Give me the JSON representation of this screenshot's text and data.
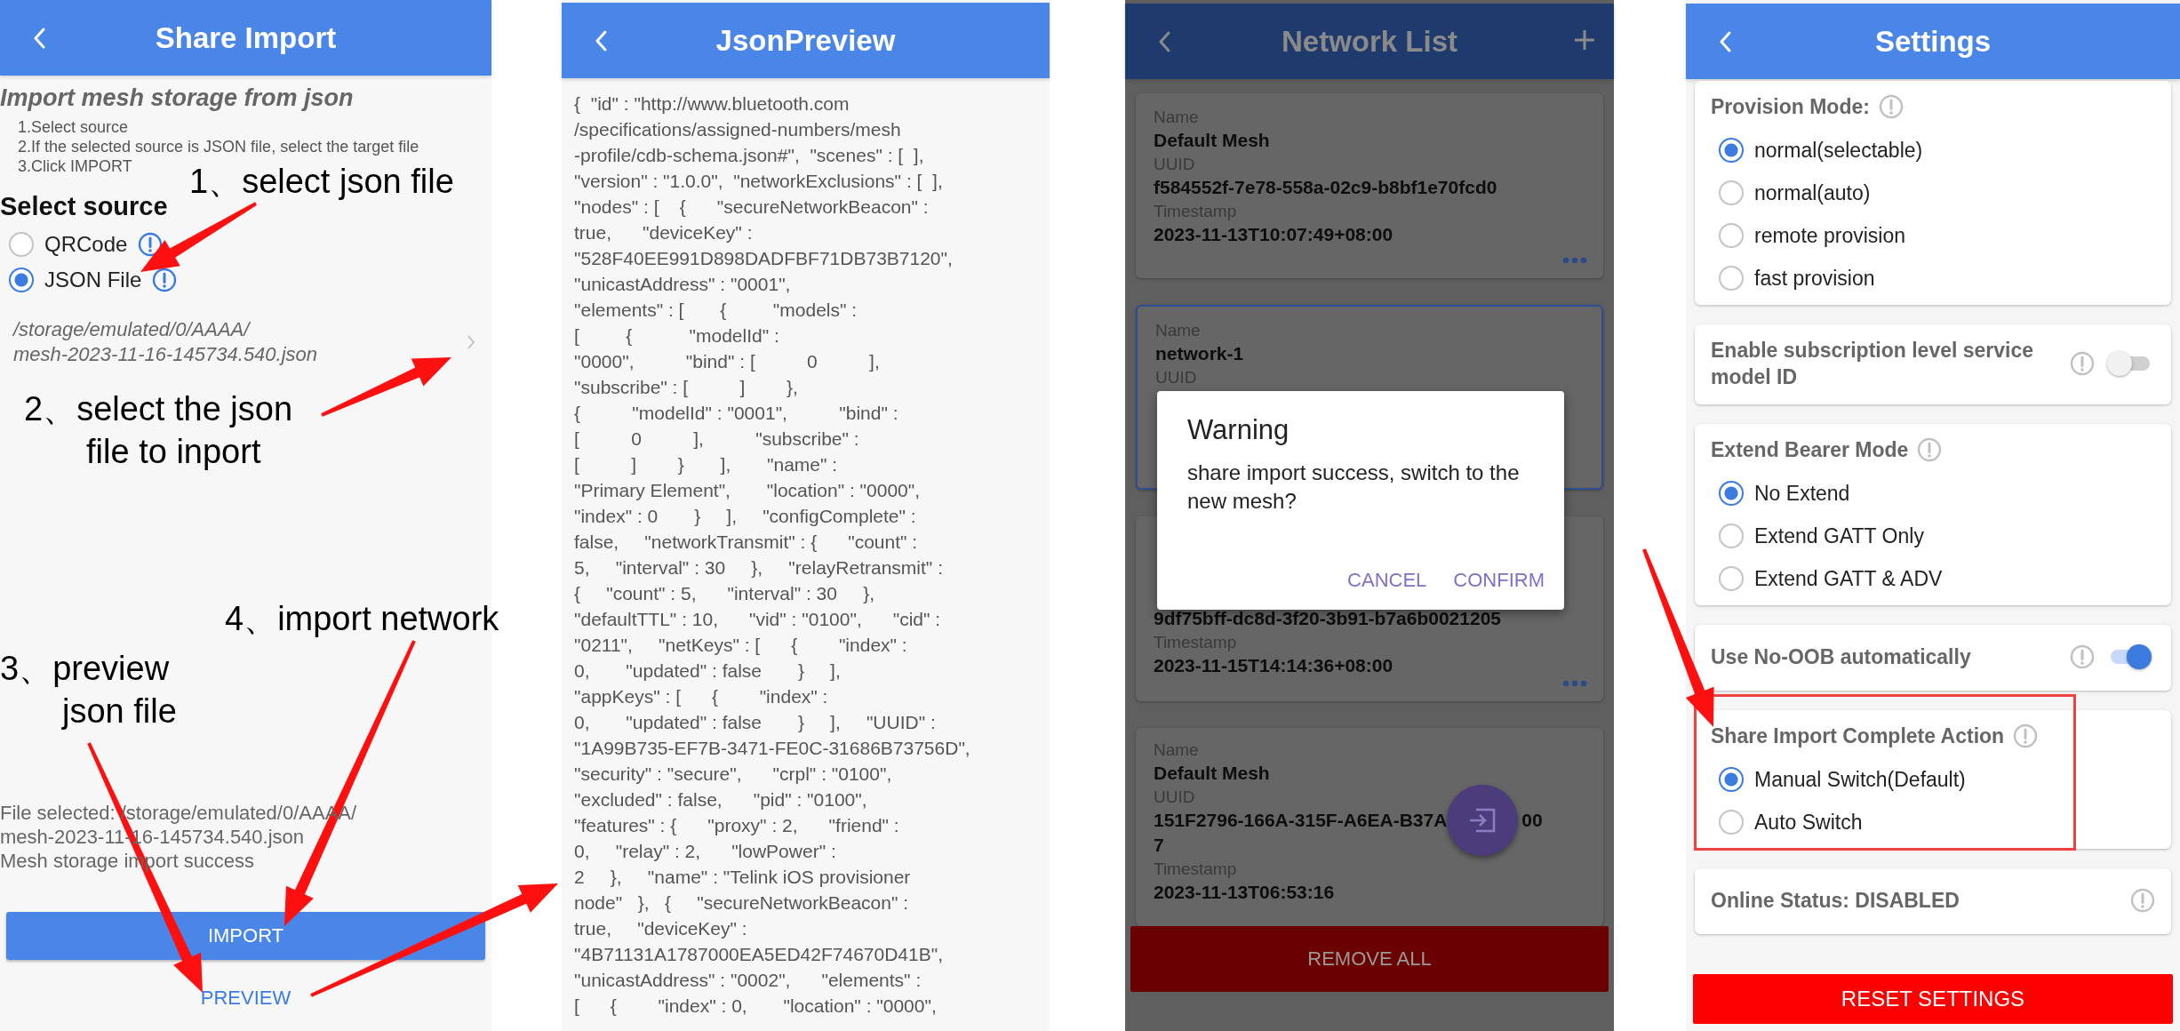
{
  "share_import": {
    "header": {
      "title": "Share Import"
    },
    "heading": "Import mesh storage from json",
    "steps": [
      "1.Select source",
      "2.If the selected source is JSON file, select the target file",
      "3.Click IMPORT"
    ],
    "source_title": "Select source",
    "sources": [
      {
        "label": "QRCode",
        "selected": false
      },
      {
        "label": "JSON File",
        "selected": true
      }
    ],
    "file_path": "/storage/emulated/0/AAAA/\nmesh-2023-11-16-145734.540.json",
    "status_lines": [
      "File selected: /storage/emulated/0/AAAA/\nmesh-2023-11-16-145734.540.json",
      "Mesh storage import success"
    ],
    "import_button": "IMPORT",
    "preview_link": "PREVIEW"
  },
  "json_preview": {
    "header": {
      "title": "JsonPreview"
    },
    "content": "{  \"id\" : \"http://www.bluetooth.com\n/specifications/assigned-numbers/mesh\n-profile/cdb-schema.json#\",  \"scenes\" : [  ],\n\"version\" : \"1.0.0\",  \"networkExclusions\" : [  ],\n\"nodes\" : [    {      \"secureNetworkBeacon\" :\ntrue,      \"deviceKey\" :\n\"528F40EE991D898DADFBF71DB73B7120\",\n\"unicastAddress\" : \"0001\",\n\"elements\" : [       {         \"models\" :\n[         {           \"modelId\" :\n\"0000\",          \"bind\" : [          0          ],\n\"subscribe\" : [          ]        },\n{          \"modelId\" : \"0001\",          \"bind\" :\n[          0          ],          \"subscribe\" :\n[          ]        }       ],       \"name\" :\n\"Primary Element\",       \"location\" : \"0000\",\n\"index\" : 0       }     ],     \"configComplete\" :\nfalse,     \"networkTransmit\" : {      \"count\" :\n5,     \"interval\" : 30     },     \"relayRetransmit\" :\n{     \"count\" : 5,      \"interval\" : 30     },\n\"defaultTTL\" : 10,      \"vid\" : \"0100\",      \"cid\" :\n\"0211\",     \"netKeys\" : [      {        \"index\" :\n0,       \"updated\" : false       }     ],\n\"appKeys\" : [      {        \"index\" :\n0,       \"updated\" : false       }     ],     \"UUID\" :\n\"1A99B735-EF7B-3471-FE0C-31686B73756D\",\n\"security\" : \"secure\",      \"crpl\" : \"0100\",\n\"excluded\" : false,      \"pid\" : \"0100\",\n\"features\" : {      \"proxy\" : 2,      \"friend\" :\n0,     \"relay\" : 2,      \"lowPower\" :\n2     },     \"name\" : \"Telink iOS provisioner\nnode\"   },   {     \"secureNetworkBeacon\" :\ntrue,     \"deviceKey\" :\n\"4B71131A1787000EA5ED42F74670D41B\",\n\"unicastAddress\" : \"0002\",      \"elements\" :\n[      {        \"index\" : 0,       \"location\" : \"0000\","
  },
  "network_list": {
    "header": {
      "title": "Network List"
    },
    "cards": [
      {
        "selected": false,
        "more_button": true,
        "fields": [
          {
            "kind": "label",
            "text": "Name"
          },
          {
            "kind": "value",
            "text": "Default Mesh"
          },
          {
            "kind": "label",
            "text": "UUID"
          },
          {
            "kind": "value",
            "text": "f584552f-7e78-558a-02c9-b8bf1e70fcd0"
          },
          {
            "kind": "label",
            "text": "Timestamp"
          },
          {
            "kind": "value",
            "text": "2023-11-13T10:07:49+08:00"
          }
        ]
      },
      {
        "selected": true,
        "more_button": false,
        "fields": [
          {
            "kind": "label",
            "text": "Name"
          },
          {
            "kind": "value",
            "text": "network-1"
          },
          {
            "kind": "label",
            "text": "UUID"
          }
        ]
      },
      {
        "selected": false,
        "more_button": true,
        "fields": [
          {
            "kind": "value",
            "text": "9df75bff-dc8d-3f20-3b91-b7a6b0021205"
          },
          {
            "kind": "label",
            "text": "Timestamp"
          },
          {
            "kind": "value",
            "text": "2023-11-15T14:14:36+08:00"
          }
        ]
      },
      {
        "selected": false,
        "more_button": false,
        "fields": [
          {
            "kind": "label",
            "text": "Name"
          },
          {
            "kind": "value",
            "text": "Default Mesh"
          },
          {
            "kind": "label",
            "text": "UUID"
          },
          {
            "kind": "split_value",
            "parts": [
              "151F2796-166A-315F-A6EA-B37A",
              "00"
            ]
          },
          {
            "kind": "value",
            "text": "7"
          },
          {
            "kind": "label",
            "text": "Timestamp"
          },
          {
            "kind": "value",
            "text": "2023-11-13T06:53:16"
          }
        ]
      }
    ],
    "dialog": {
      "title": "Warning",
      "message": "share import success, switch to the new mesh?",
      "buttons": [
        "CANCEL",
        "CONFIRM"
      ]
    },
    "remove_all_button": "REMOVE ALL"
  },
  "settings": {
    "header": {
      "title": "Settings"
    },
    "sections": [
      {
        "kind": "radio_group",
        "title": "Provision Mode:",
        "highlighted": false,
        "options": [
          {
            "label": "normal(selectable)",
            "selected": true
          },
          {
            "label": "normal(auto)",
            "selected": false
          },
          {
            "label": "remote provision",
            "selected": false
          },
          {
            "label": "fast provision",
            "selected": false
          }
        ]
      },
      {
        "kind": "toggle",
        "title": "Enable subscription level service model ID",
        "highlighted": false,
        "on": false
      },
      {
        "kind": "radio_group",
        "title": "Extend Bearer Mode",
        "highlighted": false,
        "options": [
          {
            "label": "No Extend",
            "selected": true
          },
          {
            "label": "Extend GATT Only",
            "selected": false
          },
          {
            "label": "Extend GATT & ADV",
            "selected": false
          }
        ]
      },
      {
        "kind": "toggle",
        "title": "Use No-OOB automatically",
        "highlighted": false,
        "on": true
      },
      {
        "kind": "radio_group",
        "title": "Share Import Complete Action",
        "highlighted": true,
        "options": [
          {
            "label": "Manual Switch(Default)",
            "selected": true
          },
          {
            "label": "Auto Switch",
            "selected": false
          }
        ]
      },
      {
        "kind": "info",
        "title": "Online Status: DISABLED",
        "highlighted": false
      }
    ],
    "reset_button": "RESET SETTINGS"
  },
  "annotations": [
    {
      "text": "1、select json file"
    },
    {
      "text": "2、select the json\nfile to inport"
    },
    {
      "text": "3、preview\njson file"
    },
    {
      "text": "4、import network"
    }
  ]
}
